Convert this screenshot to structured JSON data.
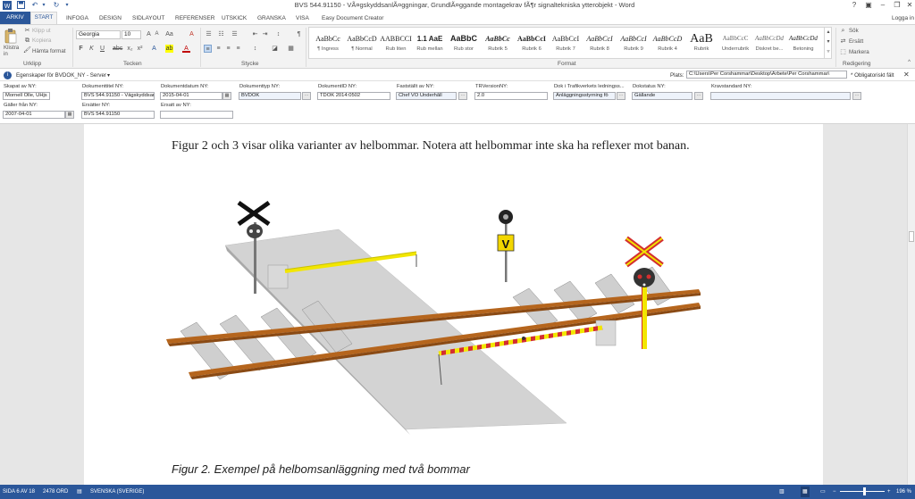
{
  "window": {
    "title": "BVS 544.91150 - VÃ¤gskyddsanlÃ¤ggningar, GrundlÃ¤ggande montagekrav fÃ¶r signaltekniska ytterobjekt - Word",
    "help": "?",
    "signin": "Logga in"
  },
  "tabs": [
    "ARKIV",
    "START",
    "INFOGA",
    "DESIGN",
    "SIDLAYOUT",
    "REFERENSER",
    "UTSKICK",
    "GRANSKA",
    "VISA",
    "Easy Document Creator"
  ],
  "ribbon": {
    "clipboard": {
      "paste": "Klistra in",
      "cut": "Klipp ut",
      "copy": "Kopiera",
      "format_painter": "Hämta format",
      "label": "Urklipp"
    },
    "font": {
      "name": "Georgia",
      "size": "10",
      "label": "Tecken"
    },
    "paragraph": {
      "label": "Stycke"
    },
    "styles": {
      "label": "Format",
      "items": [
        {
          "preview": "AaBbCc",
          "name": "¶ Ingress"
        },
        {
          "preview": "AaBbCcD",
          "name": "¶ Normal"
        },
        {
          "preview": "AABBCCI",
          "name": "Rub liten"
        },
        {
          "preview": "1.1 AaE",
          "name": "Rub mellan"
        },
        {
          "preview": "AaBbC",
          "name": "Rub stor"
        },
        {
          "preview": "AaBbCc",
          "name": "Rubrik 5"
        },
        {
          "preview": "AaBbCcI",
          "name": "Rubrik 6"
        },
        {
          "preview": "AaBbCcI",
          "name": "Rubrik 7"
        },
        {
          "preview": "AaBbCcI",
          "name": "Rubrik 8"
        },
        {
          "preview": "AaBbCcI",
          "name": "Rubrik 9"
        },
        {
          "preview": "AaBbCcD",
          "name": "Rubrik 4"
        },
        {
          "preview": "AaB",
          "name": "Rubrik"
        },
        {
          "preview": "AaBbCcC",
          "name": "Underrubrik"
        },
        {
          "preview": "AaBbCcDd",
          "name": "Diskret be..."
        },
        {
          "preview": "AaBbCcDd",
          "name": "Betoning"
        }
      ]
    },
    "editing": {
      "find": "Sök",
      "replace": "Ersätt",
      "select": "Markera",
      "label": "Redigering"
    }
  },
  "docprops": {
    "title": "Egenskaper för BVDOK_NY - Server",
    "location_label": "Plats:",
    "location_value": "C:\\Users\\Per Corshammar\\Desktop\\Arbete\\Per Corshammar\\",
    "required_note": "* Obligatoriskt fält"
  },
  "fields": [
    {
      "label": "Skapat av NY:",
      "value": "Mornell Olle, UHjs"
    },
    {
      "label": "Dokumenttitel NY:",
      "value": "BVS 544.91150 - Vägskyddsar"
    },
    {
      "label": "Dokumentdatum NY:",
      "value": "2015-04-01"
    },
    {
      "label": "Dokumenttyp NY:",
      "value": "BVDOK"
    },
    {
      "label": "DokumentID NY:",
      "value": "TDOK 2014:0502"
    },
    {
      "label": "Fastställt av NY:",
      "value": "Chef VO Underhåll"
    },
    {
      "label": "TRVersionNY:",
      "value": "2.0"
    },
    {
      "label": "Dok i Trafikverkets ledningss...",
      "value": "Anläggningsstyrning fö"
    },
    {
      "label": "Dokstatus NY:",
      "value": "Gällande"
    },
    {
      "label": "Kravstandard NY:",
      "value": ""
    },
    {
      "label": "Gäller från NY:",
      "value": "2007-04-01"
    },
    {
      "label": "Ersätter NY:",
      "value": "BVS 544.91150"
    },
    {
      "label": "Ersatt av NY:",
      "value": ""
    }
  ],
  "document": {
    "paragraph": "Figur 2 och 3 visar olika varianter av helbommar. Notera att helbommar inte ska ha reflexer mot banan.",
    "sign_letter": "V",
    "caption": "Figur 2. Exempel på helbomsanläggning med två bommar"
  },
  "status": {
    "page": "SIDA 6 AV 18",
    "words": "2478 ORD",
    "language": "SVENSKA (SVERIGE)",
    "zoom": "196 %"
  },
  "colors": {
    "accent": "#2b579a",
    "rail": "#b5651d",
    "barrier_red": "#d32f2f",
    "barrier_yellow": "#f2e600"
  }
}
